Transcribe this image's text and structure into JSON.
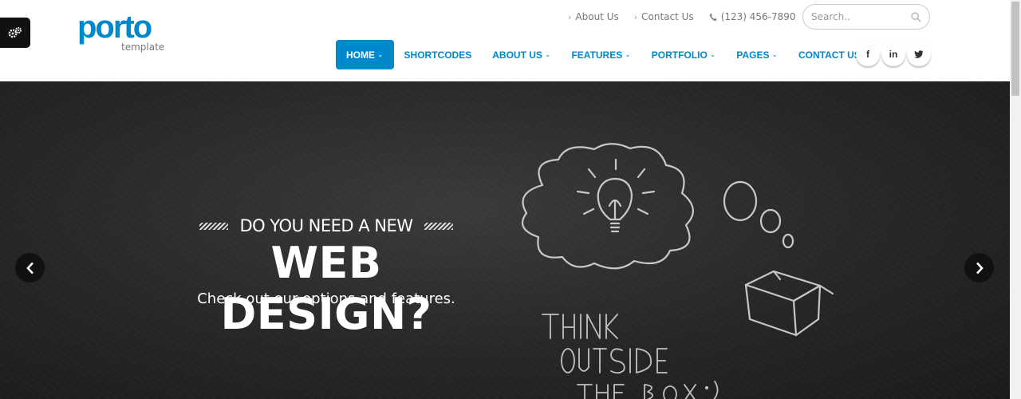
{
  "logo": {
    "name": "porto",
    "tagline": "template"
  },
  "top_links": [
    {
      "label": "About Us"
    },
    {
      "label": "Contact Us"
    }
  ],
  "phone": "(123) 456-7890",
  "search": {
    "placeholder": "Search.."
  },
  "nav": [
    {
      "label": "HOME",
      "active": true,
      "has_dropdown": true
    },
    {
      "label": "SHORTCODES",
      "active": false,
      "has_dropdown": false
    },
    {
      "label": "ABOUT US",
      "active": false,
      "has_dropdown": true
    },
    {
      "label": "FEATURES",
      "active": false,
      "has_dropdown": true
    },
    {
      "label": "PORTFOLIO",
      "active": false,
      "has_dropdown": true
    },
    {
      "label": "PAGES",
      "active": false,
      "has_dropdown": true
    },
    {
      "label": "CONTACT US",
      "active": false,
      "has_dropdown": true
    }
  ],
  "social": [
    {
      "icon": "facebook-icon",
      "glyph": "f"
    },
    {
      "icon": "linkedin-icon",
      "glyph": "in"
    },
    {
      "icon": "twitter-icon",
      "glyph": "t"
    }
  ],
  "slide": {
    "pre_title": "DO YOU NEED A NEW",
    "title": "WEB DESIGN?",
    "subtitle": "Check out our options and features.",
    "chalk_lines": [
      "THINK",
      "OUTSIDE",
      "THE BOX :)"
    ]
  },
  "colors": {
    "accent": "#0088cc",
    "slide_bg": "#262626"
  }
}
